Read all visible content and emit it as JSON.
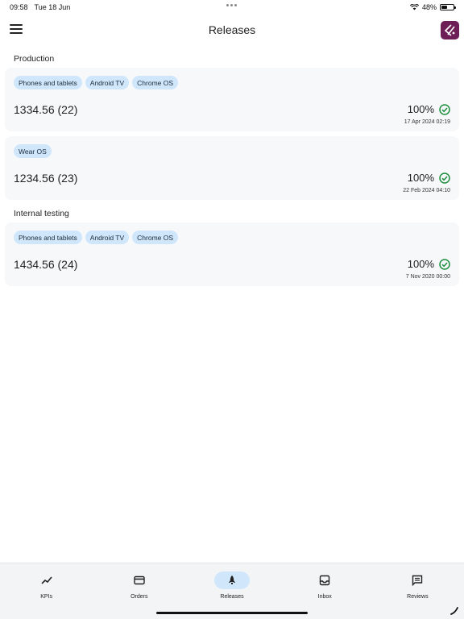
{
  "status_bar": {
    "time": "09:58",
    "date": "Tue 18 Jun",
    "battery_percent": "48%",
    "battery_level": 0.48
  },
  "app_bar": {
    "title": "Releases"
  },
  "sections": [
    {
      "title": "Production",
      "cards": [
        {
          "chips": [
            "Phones and tablets",
            "Android TV",
            "Chrome OS"
          ],
          "version": "1334.56 (22)",
          "rollout": "100%",
          "date": "17 Apr 2024 02:19"
        },
        {
          "chips": [
            "Wear OS"
          ],
          "version": "1234.56 (23)",
          "rollout": "100%",
          "date": "22 Feb 2024 04:10"
        }
      ]
    },
    {
      "title": "Internal testing",
      "cards": [
        {
          "chips": [
            "Phones and tablets",
            "Android TV",
            "Chrome OS"
          ],
          "version": "1434.56 (24)",
          "rollout": "100%",
          "date": "7 Nov 2020 00:00"
        }
      ]
    }
  ],
  "bottom_nav": [
    {
      "label": "KPIs",
      "icon": "trending-up-icon",
      "active": false
    },
    {
      "label": "Orders",
      "icon": "credit-card-icon",
      "active": false
    },
    {
      "label": "Releases",
      "icon": "rocket-icon",
      "active": true
    },
    {
      "label": "Inbox",
      "icon": "inbox-icon",
      "active": false
    },
    {
      "label": "Reviews",
      "icon": "reviews-icon",
      "active": false
    }
  ],
  "colors": {
    "accent": "#cfe6fb",
    "check": "#1e8e3e",
    "logo": "#6e1e56"
  }
}
